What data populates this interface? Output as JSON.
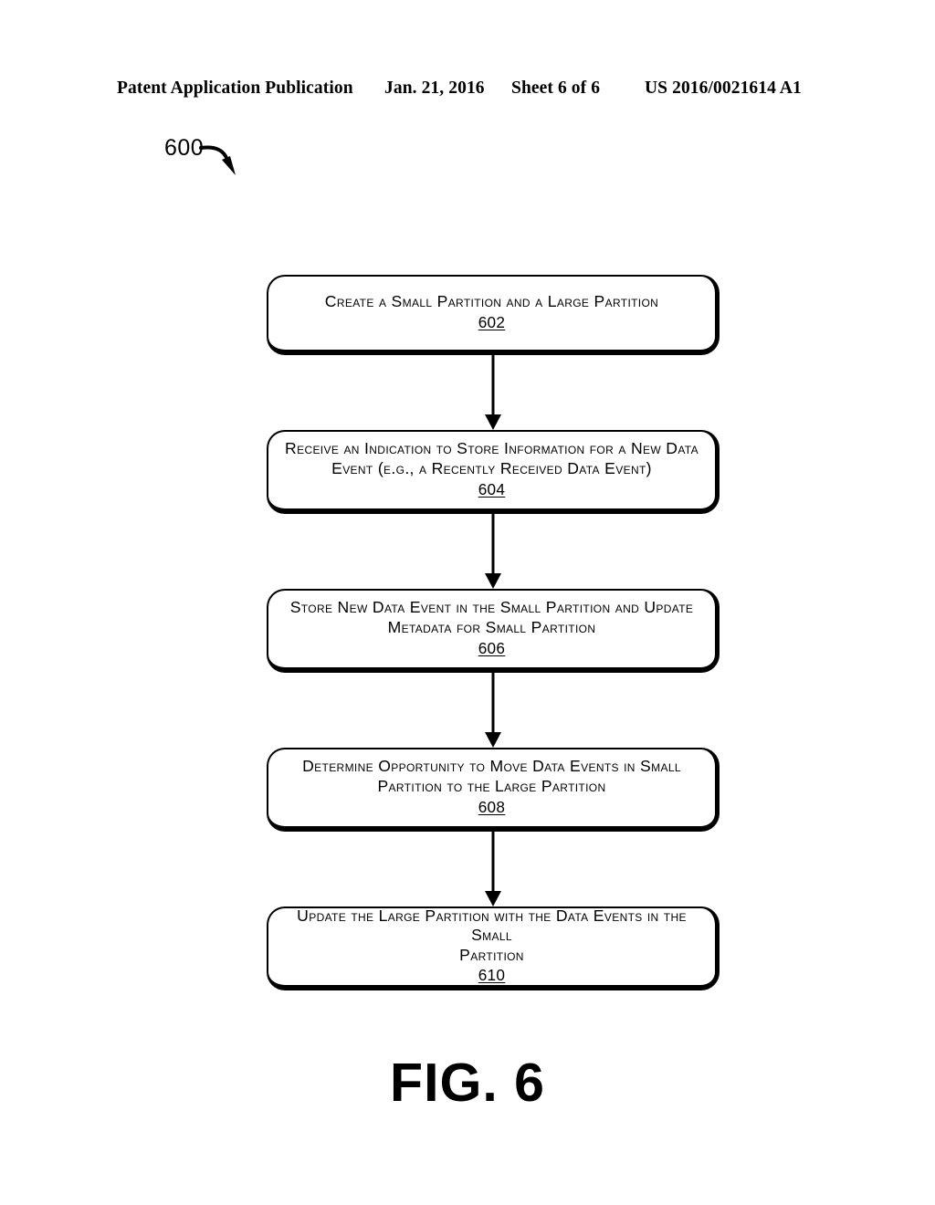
{
  "header": {
    "publication_label": "Patent Application Publication",
    "date": "Jan. 21, 2016",
    "sheet": "Sheet 6 of 6",
    "publication_number": "US 2016/0021614 A1"
  },
  "figure": {
    "reference_numeral": "600",
    "caption": "FIG. 6",
    "leader_arrow_icon": "curved-arrow-icon"
  },
  "flowchart": {
    "type": "process-flow",
    "orientation": "vertical",
    "connector_icon": "down-arrow-icon",
    "nodes": [
      {
        "id": "602",
        "text": "Create a Small Partition and a Large Partition",
        "number": "602",
        "lines": 1
      },
      {
        "id": "604",
        "text": "Receive an Indication to Store Information for a New Data\nEvent (e.g., a Recently Received Data Event)",
        "number": "604",
        "lines": 2
      },
      {
        "id": "606",
        "text": "Store New Data Event in the Small Partition and Update\nMetadata for Small Partition",
        "number": "606",
        "lines": 2
      },
      {
        "id": "608",
        "text": "Determine Opportunity to Move Data Events in Small\nPartition to the Large Partition",
        "number": "608",
        "lines": 2
      },
      {
        "id": "610",
        "text": "Update the Large Partition with the Data Events in the Small\nPartition",
        "number": "610",
        "lines": 2
      }
    ],
    "edges": [
      {
        "from": "602",
        "to": "604"
      },
      {
        "from": "604",
        "to": "606"
      },
      {
        "from": "606",
        "to": "608"
      },
      {
        "from": "608",
        "to": "610"
      }
    ]
  },
  "colors": {
    "ink": "#000000",
    "page": "#ffffff"
  }
}
